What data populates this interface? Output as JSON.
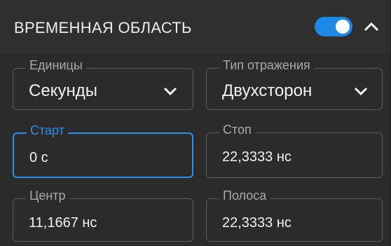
{
  "panel": {
    "title": "ВРЕМЕННАЯ ОБЛАСТЬ",
    "enabled": true,
    "accent_color": "#1e88e5"
  },
  "fields": {
    "units": {
      "label": "Единицы",
      "value": "Секунды"
    },
    "reflection_type": {
      "label": "Тип отражения",
      "value": "Двухсторон"
    },
    "start": {
      "label": "Старт",
      "value": "0 с"
    },
    "stop": {
      "label": "Стоп",
      "value": "22,3333 нс"
    },
    "center": {
      "label": "Центр",
      "value": "11,1667 нс"
    },
    "span": {
      "label": "Полоса",
      "value": "22,3333 нс"
    }
  },
  "icons": {
    "toggle": "toggle-switch-icon",
    "collapse": "chevron-up-icon",
    "dropdown": "chevron-down-icon"
  }
}
